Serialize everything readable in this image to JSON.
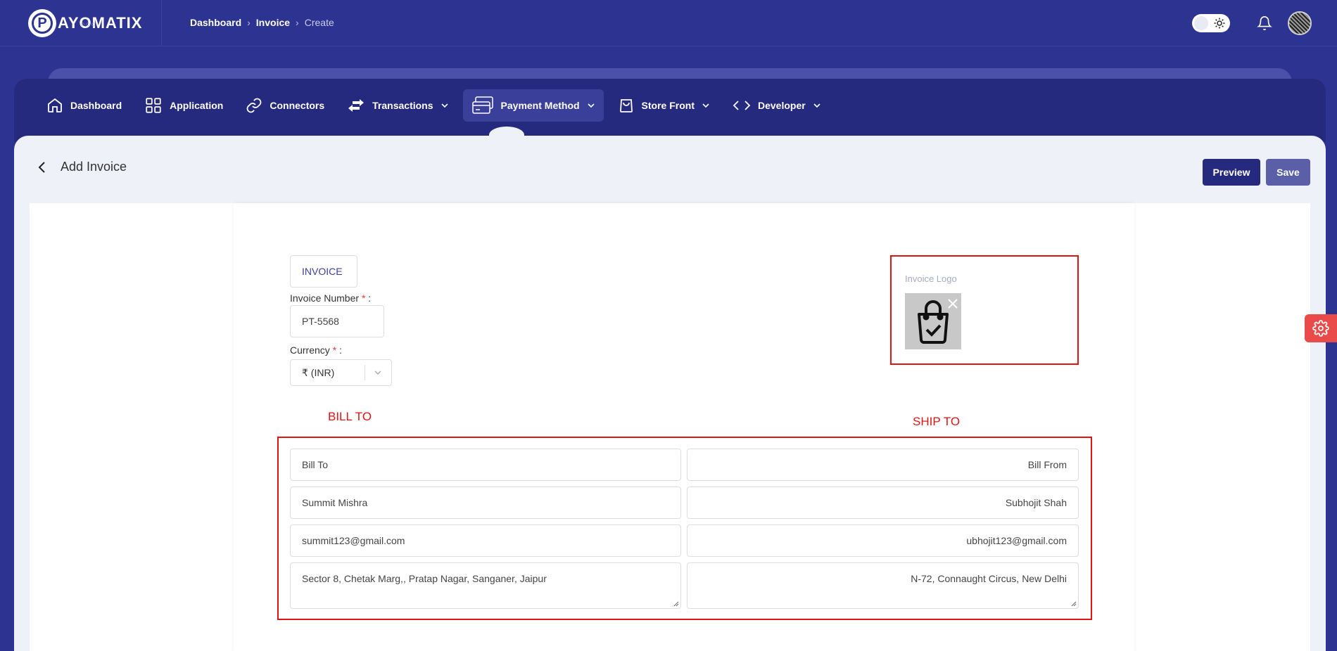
{
  "brand": {
    "name": "AYOMATIX",
    "badge_letter": "P",
    "dots": "○○○"
  },
  "breadcrumb": [
    "Dashboard",
    "Invoice",
    "Create"
  ],
  "nav": [
    {
      "label": "Dashboard",
      "icon": "home-icon",
      "dropdown": false
    },
    {
      "label": "Application",
      "icon": "grid-icon",
      "dropdown": false
    },
    {
      "label": "Connectors",
      "icon": "link-icon",
      "dropdown": false
    },
    {
      "label": "Transactions",
      "icon": "transfer-icon",
      "dropdown": true
    },
    {
      "label": "Payment Method",
      "icon": "card-icon",
      "dropdown": true,
      "active": true
    },
    {
      "label": "Store Front",
      "icon": "bag-icon",
      "dropdown": true
    },
    {
      "label": "Developer",
      "icon": "code-icon",
      "dropdown": true
    }
  ],
  "page": {
    "title": "Add Invoice",
    "preview_label": "Preview",
    "save_label": "Save"
  },
  "invoice": {
    "tag": "INVOICE",
    "number_label": "Invoice Number",
    "number_value": "PT-5568",
    "currency_label": "Currency",
    "currency_value": "₹ (INR)",
    "required_mark": "*",
    "colon": ":",
    "logo_label": "Invoice Logo"
  },
  "annotations": {
    "bill_to": "BILL TO",
    "ship_to": "SHIP TO"
  },
  "bill_to": {
    "heading": "Bill To",
    "name": "Summit Mishra",
    "email": "summit123@gmail.com",
    "address": "Sector 8, Chetak Marg,, Pratap Nagar, Sanganer, Jaipur"
  },
  "bill_from": {
    "heading": "Bill From",
    "name": "Subhojit Shah",
    "email": "ubhojit123@gmail.com",
    "address": "N-72, Connaught Circus, New Delhi"
  },
  "colors": {
    "brand": "#2d3391",
    "nav": "#262a7f",
    "annotation": "#e11414",
    "settings": "#e94b4b"
  }
}
